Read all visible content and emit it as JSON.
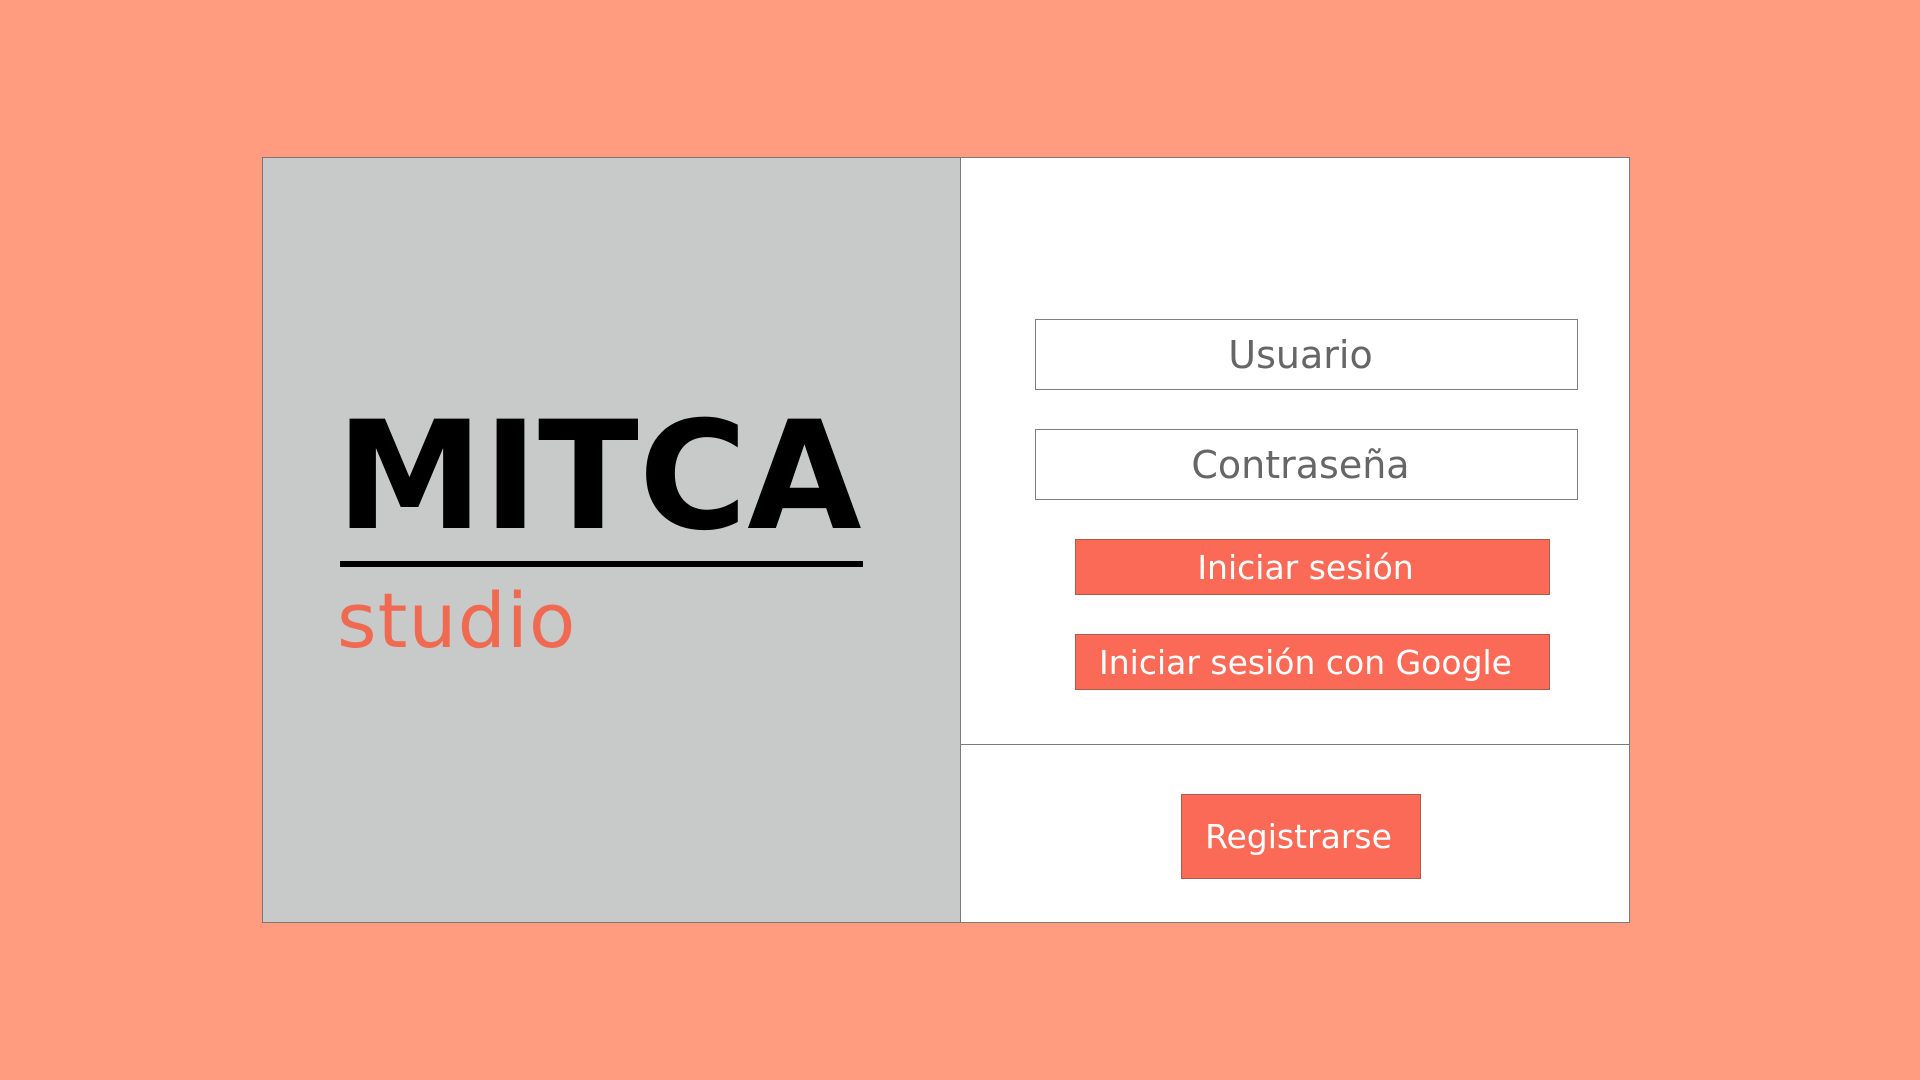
{
  "logo": {
    "title": "MITCA",
    "subtitle": "studio"
  },
  "login_form": {
    "username_placeholder": "Usuario",
    "password_placeholder": "Contraseña",
    "login_button_label": "Iniciar sesión",
    "google_button_label": "Iniciar sesión con Google"
  },
  "register": {
    "button_label": "Registrarse"
  },
  "colors": {
    "page_background": "#ff9c80",
    "accent": "#fa6a56",
    "logo_panel_background": "#c8c9c9",
    "subtitle_color": "#f06a52"
  }
}
